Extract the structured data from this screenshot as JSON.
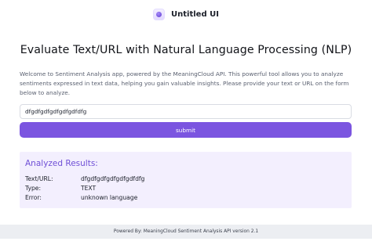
{
  "brand": {
    "name": "Untitled UI"
  },
  "headline": "Evaluate Text/URL with Natural Language Processing (NLP)",
  "intro": "Welcome to Sentiment Analysis app, powered by the MeaningCloud API. This powerful tool allows you to analyze sentiments expressed in text data, helping you gain valuable insights. Please provide your text or URL on the form below to analyze.",
  "form": {
    "input_value": "dfgdfgdfgdfgdfgdfdfg",
    "submit_label": "submit"
  },
  "results": {
    "title": "Analyzed Results:",
    "rows": [
      {
        "label": "Text/URL:",
        "value": "dfgdfgdfgdfgdfgdfdfg"
      },
      {
        "label": "Type:",
        "value": "TEXT"
      },
      {
        "label": "Error:",
        "value": "unknown language"
      }
    ]
  },
  "footer": {
    "text": "Powered By: MeaningCloud Sentiment Analysis API version 2.1"
  },
  "colors": {
    "accent": "#7b55e0",
    "results_bg": "#f3effe",
    "results_title": "#6f4fd6",
    "footer_bg": "#eceef2"
  },
  "icons": {
    "brand_logo": "brand-logo-icon"
  }
}
